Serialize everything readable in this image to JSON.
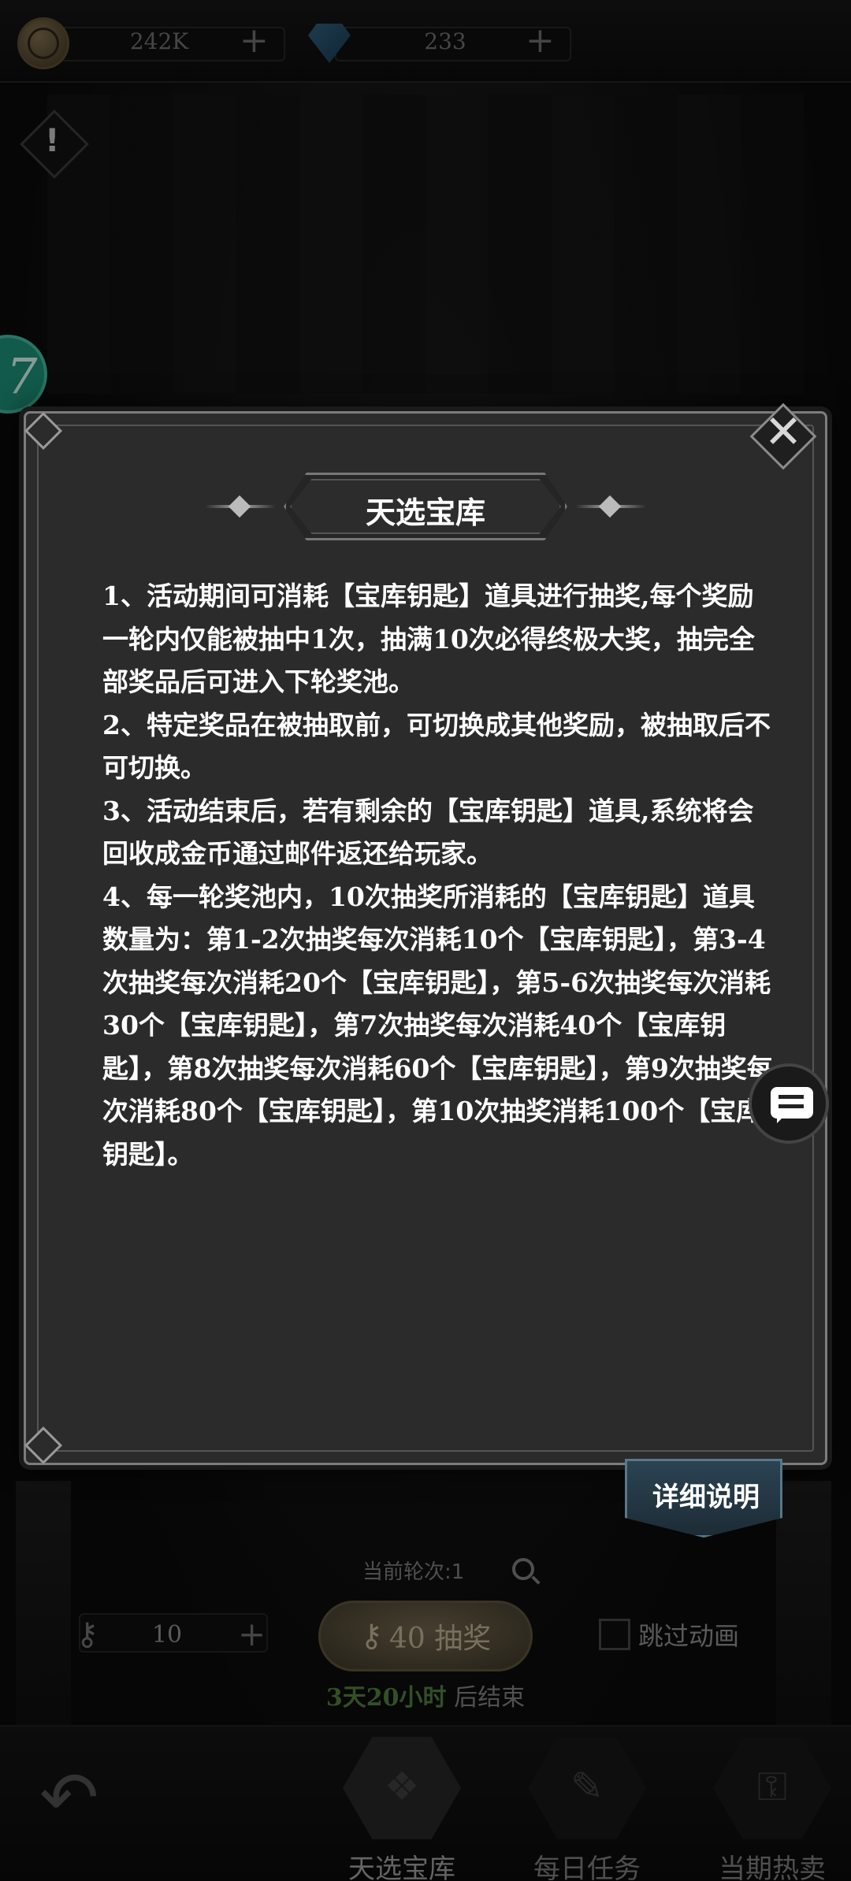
{
  "resources": {
    "gold": "242K",
    "gems": "233",
    "add_symbol": "+"
  },
  "side": {
    "alert_symbol": "!",
    "badge_symbol": "7"
  },
  "modal": {
    "title": "天选宝库",
    "close_symbol": "✕",
    "rules": [
      "1、活动期间可消耗【宝库钥匙】道具进行抽奖,每个奖励一轮内仅能被抽中1次，抽满10次必得终极大奖，抽完全部奖品后可进入下轮奖池。",
      "2、特定奖品在被抽取前，可切换成其他奖励，被抽取后不可切换。",
      "3、活动结束后，若有剩余的【宝库钥匙】道具,系统将会回收成金币通过邮件返还给玩家。",
      "4、每一轮奖池内，10次抽奖所消耗的【宝库钥匙】道具数量为：第1-2次抽奖每次消耗10个【宝库钥匙】，第3-4次抽奖每次消耗20个【宝库钥匙】，第5-6次抽奖每次消耗30个【宝库钥匙】，第7次抽奖每次消耗40个【宝库钥匙】，第8次抽奖每次消耗60个【宝库钥匙】，第9次抽奖每次消耗80个【宝库钥匙】，第10次抽奖消耗100个【宝库钥匙】。"
    ],
    "detail_button": "详细说明"
  },
  "draw": {
    "current_round": "当前轮次:1",
    "key_count": "10",
    "draw_button": "40 抽奖",
    "skip_animation": "跳过动画",
    "timer_highlight": "3天20小时",
    "timer_suffix": " 后结束"
  },
  "nav": {
    "tabs": [
      {
        "label": "天选宝库",
        "icon": "❖"
      },
      {
        "label": "每日任务",
        "icon": "✎"
      },
      {
        "label": "当期热卖",
        "icon": "⚿"
      }
    ],
    "back_symbol": "↶"
  },
  "colors": {
    "modal_bg": "#2b2b2b",
    "modal_border": "#7c7c7c",
    "accent_green": "#1d8a74",
    "timer_green": "#4e7a3e",
    "detail_button": "#2b4352"
  }
}
